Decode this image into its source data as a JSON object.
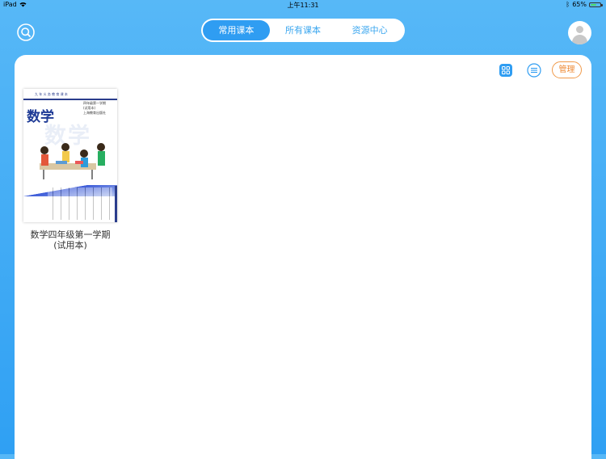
{
  "status_bar": {
    "device": "iPad",
    "time": "上午11:31",
    "battery": "65%",
    "battery_level": 0.65
  },
  "header": {
    "tabs": [
      {
        "label": "常用课本",
        "active": true
      },
      {
        "label": "所有课本",
        "active": false
      },
      {
        "label": "资源中心",
        "active": false
      }
    ]
  },
  "toolbar": {
    "manage_label": "管理"
  },
  "books": [
    {
      "cover": {
        "series": "九 年 义 务 教 育 课 本",
        "title": "数学",
        "grade": "四年级",
        "term": "第一学期",
        "edition": "(试用本)",
        "publisher": "上海教育出版社"
      },
      "title_line1": "数学四年级第一学期",
      "title_line2": "(试用本)"
    }
  ],
  "colors": {
    "accent": "#2f9df2",
    "manage": "#ee8a35",
    "cover_blue": "#1f3b96"
  }
}
